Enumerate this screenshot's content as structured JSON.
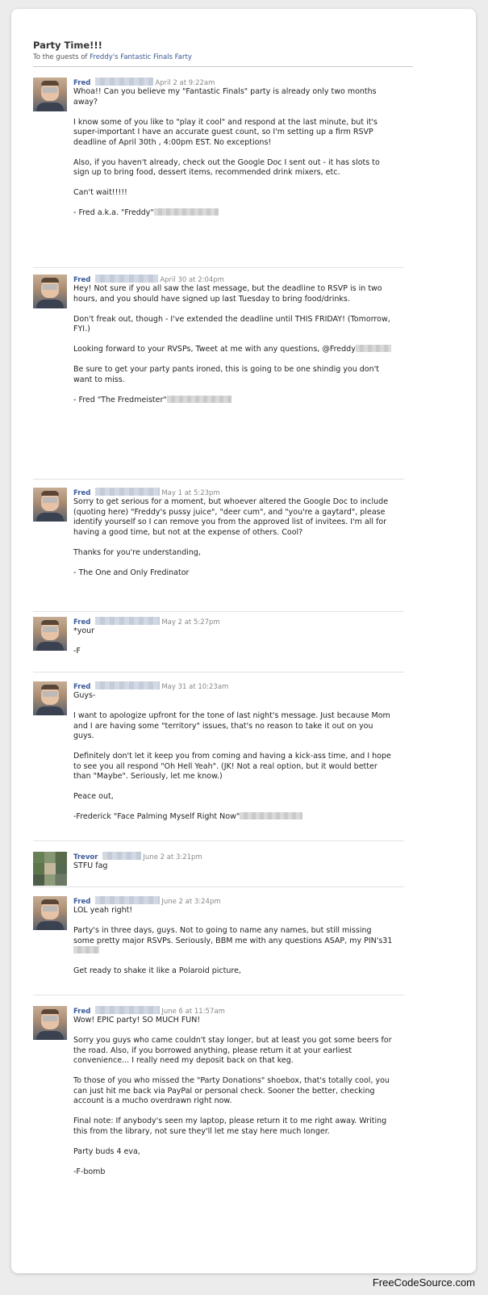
{
  "header": {
    "title": "Party Time!!!",
    "subtitle_prefix": "To the guests of",
    "event_link": "Freddy's Fantastic Finals Farty"
  },
  "messages": [
    {
      "author": "Fred",
      "date": "April 2 at 9:22am",
      "paragraphs": [
        "Whoa!! Can you believe my \"Fantastic Finals\" party is already only two months away?",
        "I know some of you like to \"play it cool\" and respond at the last minute, but it's super-important I have an accurate guest count, so I'm setting up a firm RSVP deadline of April 30th , 4:00pm EST. No exceptions!",
        "Also, if you haven't already, check out the Google Doc I sent out - it has slots to sign up to bring food, dessert items, recommended drink mixers, etc.",
        "Can't wait!!!!!",
        "- Fred a.k.a. \"Freddy\""
      ]
    },
    {
      "author": "Fred",
      "date": "April 30 at 2:04pm",
      "paragraphs": [
        "Hey! Not sure if you all saw the last message, but the deadline to RSVP is in two hours, and you should have signed up last Tuesday to bring food/drinks.",
        "Don't freak out, though - I've extended the deadline until THIS FRIDAY! (Tomorrow, FYI.)",
        "Looking forward to your RVSPs, Tweet at me with any questions, @Freddy",
        "Be sure to get your party pants ironed, this is going to be one shindig you don't want to miss.",
        "- Fred \"The Fredmeister\""
      ]
    },
    {
      "author": "Fred",
      "date": "May 1 at 5:23pm",
      "paragraphs": [
        "Sorry to get serious for a moment, but whoever altered the Google Doc to include (quoting here) \"Freddy's pussy juice\", \"deer cum\", and \"you're a gaytard\", please identify yourself so I can remove you from the approved list of invitees. I'm all for having a good time, but not at the expense of others. Cool?",
        "Thanks for you're understanding,",
        "- The One and Only Fredinator"
      ]
    },
    {
      "author": "Fred",
      "date": "May 2 at 5:27pm",
      "paragraphs": [
        "*your",
        "-F"
      ]
    },
    {
      "author": "Fred",
      "date": "May 31 at 10:23am",
      "paragraphs": [
        "Guys-",
        "I want to apologize upfront for the tone of last night's message. Just because Mom and I are having some \"territory\" issues, that's no reason to take it out on you guys.",
        "Definitely don't let it keep you from coming and having a kick-ass time, and I hope to see you all respond \"Oh Hell Yeah\". (JK! Not a real option, but it would better than \"Maybe\". Seriously, let me know.)",
        "Peace out,",
        "-Frederick \"Face Palming Myself Right Now\""
      ]
    },
    {
      "author": "Trevor",
      "date": "June 2 at 3:21pm",
      "paragraphs": [
        "STFU fag"
      ]
    },
    {
      "author": "Fred",
      "date": "June 2 at 3:24pm",
      "paragraphs": [
        "LOL yeah right!",
        "Party's in three days, guys. Not to going to name any names, but still missing some pretty major RSVPs. Seriously, BBM me with any questions ASAP, my PIN's31",
        "Get ready to shake it like a Polaroid picture,"
      ]
    },
    {
      "author": "Fred",
      "date": "June 6 at 11:57am",
      "paragraphs": [
        "Wow! EPIC party! SO MUCH FUN!",
        "Sorry you guys who came couldn't stay longer, but at least you got some beers for the road. Also, if you borrowed anything, please return it at your earliest convenience... I really need my deposit back on that keg.",
        "To those of you who missed the \"Party Donations\" shoebox, that's totally cool, you can just hit me back via PayPal or personal check. Sooner the better, checking account is a mucho overdrawn right now.",
        "Final note: If anybody's seen my laptop, please return it to me right away. Writing this from the library, not sure they'll let me stay here much longer.",
        "Party buds 4 eva,",
        "-F-bomb"
      ]
    }
  ],
  "watermark": "FreeCodeSource.com"
}
